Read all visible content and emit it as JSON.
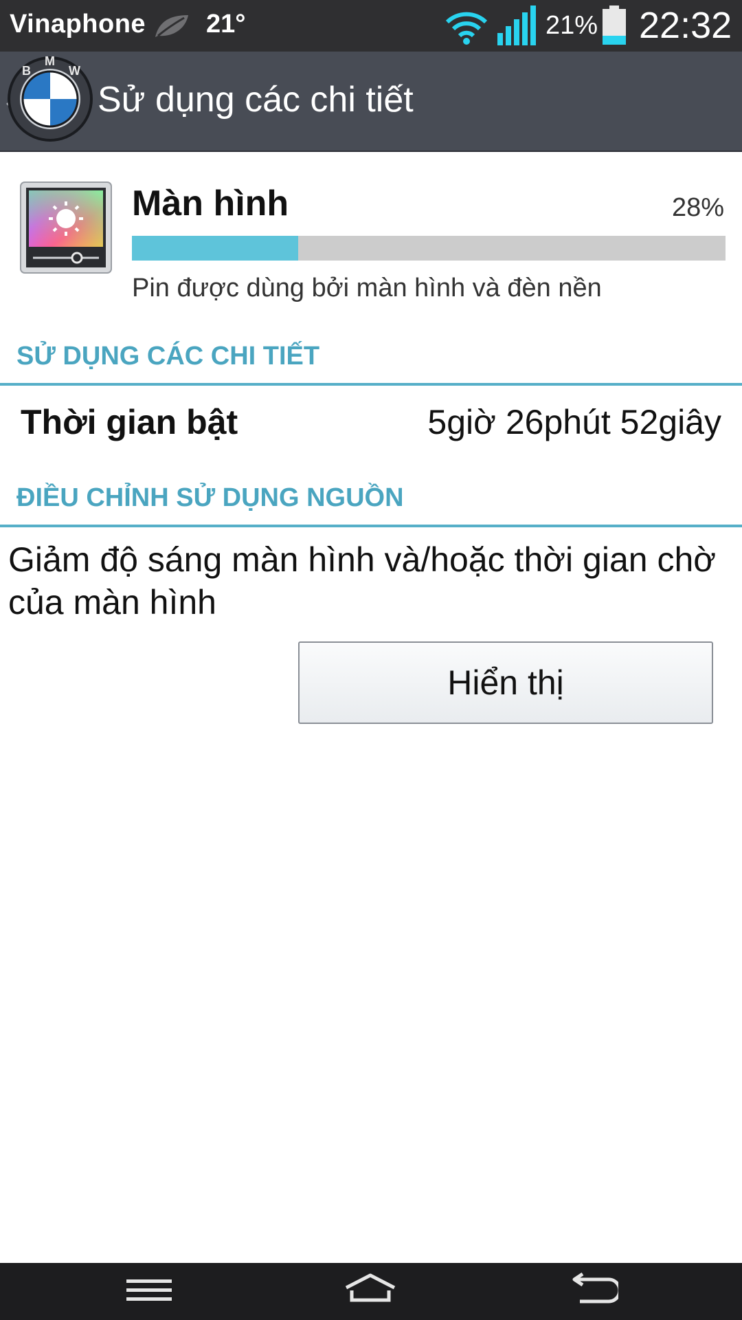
{
  "status_bar": {
    "carrier": "Vinaphone",
    "temperature": "21°",
    "battery_percent": "21%",
    "time": "22:32",
    "icons": [
      "leaf-icon",
      "wifi-icon",
      "signal-icon",
      "battery-icon"
    ],
    "accent_color": "#29d3ef"
  },
  "action_bar": {
    "title": "Sử dụng các chi tiết",
    "logo_letters": [
      "B",
      "M",
      "W"
    ]
  },
  "usage": {
    "title": "Màn hình",
    "percent_label": "28%",
    "progress_fraction": 0.28,
    "description": "Pin được dùng bởi màn hình và đèn nền",
    "bar_color": "#5ec4da"
  },
  "details_section": {
    "header": "SỬ DỤNG CÁC CHI TIẾT",
    "on_time_label": "Thời gian bật",
    "on_time_value": "5giờ 26phút 52giây"
  },
  "adjust_section": {
    "header": "ĐIỀU CHỈNH SỬ DỤNG NGUỒN",
    "advice": "Giảm độ sáng màn hình và/hoặc thời gian chờ của màn hình",
    "button_label": "Hiển thị"
  },
  "nav_bar": {
    "icons": [
      "menu-icon",
      "home-icon",
      "back-icon"
    ]
  },
  "section_color": "#4aa5c0"
}
